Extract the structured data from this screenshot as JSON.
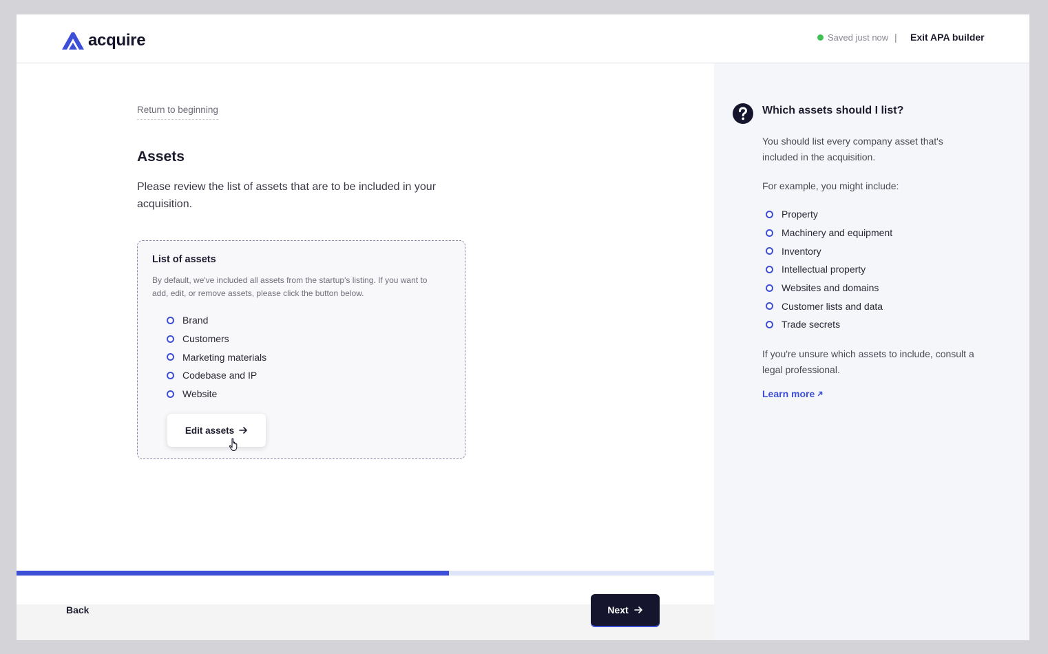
{
  "header": {
    "brand": "acquire",
    "save_status": "Saved just now",
    "separator": "|",
    "exit_label": "Exit APA builder"
  },
  "main": {
    "return_link": "Return to beginning",
    "title": "Assets",
    "description": "Please review the list of assets that are to be included in your acquisition.",
    "card": {
      "title": "List of assets",
      "description": "By default, we've included all assets from the startup's listing. If you want to add, edit, or remove assets, please click the button below.",
      "items": [
        "Brand",
        "Customers",
        "Marketing materials",
        "Codebase and IP",
        "Website"
      ],
      "button_label": "Edit assets"
    }
  },
  "progress": {
    "fraction": 0.62
  },
  "footer": {
    "back_label": "Back",
    "next_label": "Next"
  },
  "help": {
    "title": "Which assets should I list?",
    "intro": "You should list every company asset that's included in the acquisition.",
    "example_lead": "For example, you might include:",
    "items": [
      "Property",
      "Machinery and equipment",
      "Inventory",
      "Intellectual property",
      "Websites and domains",
      "Customer lists and data",
      "Trade secrets"
    ],
    "note": "If you're unsure which assets to include, consult a legal professional.",
    "learn_more": "Learn more"
  },
  "colors": {
    "accent": "#3d4fd6",
    "dark": "#15152e",
    "status_green": "#3fc155"
  }
}
